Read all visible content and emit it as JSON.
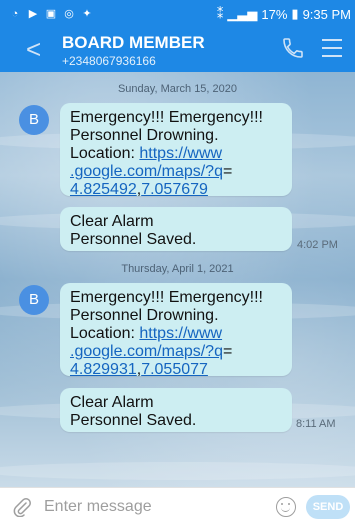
{
  "status_bar": {
    "battery": "17%",
    "time": "9:35 PM"
  },
  "header": {
    "contact_name": "BOARD MEMBER",
    "contact_number": "+2348067936166"
  },
  "messages": [
    {
      "date": "Sunday, March 15, 2020",
      "avatar_letter": "B",
      "alert": {
        "line1": "Emergency!!! Emergency!!!",
        "line2": "Personnel Drowning.",
        "location_label": "Location: ",
        "link_part1": "https://www",
        "link_part2": ".google.com/maps/?q",
        "link_eq": "=",
        "coord_lat": "4.825492",
        "coord_sep": ",",
        "coord_lon": "7.057679"
      },
      "clear": {
        "line1": "Clear Alarm",
        "line2": "Personnel Saved."
      },
      "time": "4:02 PM"
    },
    {
      "date": "Thursday, April 1, 2021",
      "avatar_letter": "B",
      "alert": {
        "line1": "Emergency!!! Emergency!!!",
        "line2": "Personnel Drowning.",
        "location_label": "Location: ",
        "link_part1": "https://www",
        "link_part2": ".google.com/maps/?q",
        "link_eq": "=",
        "coord_lat": "4.829931",
        "coord_sep": ",",
        "coord_lon": "7.055077"
      },
      "clear": {
        "line1": "Clear Alarm",
        "line2": "Personnel Saved."
      },
      "time": "8:11 AM"
    }
  ],
  "composer": {
    "placeholder": "Enter message",
    "send_label": "SEND"
  }
}
